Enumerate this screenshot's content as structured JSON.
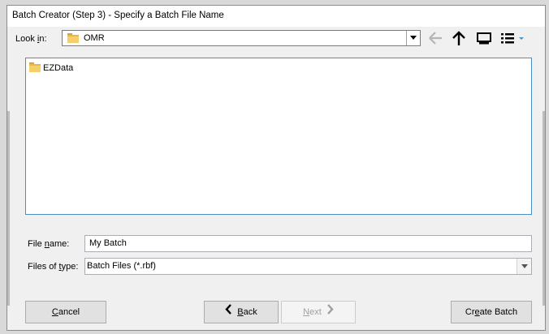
{
  "window": {
    "title": "Batch Creator (Step 3) - Specify a Batch File Name"
  },
  "lookin": {
    "label_pre": "Look ",
    "label_accel": "i",
    "label_post": "n:",
    "value": "OMR"
  },
  "toolbar": {
    "icons": [
      "back-arrow-icon",
      "up-folder-icon",
      "desktop-icon",
      "view-menu-icon"
    ]
  },
  "files": [
    {
      "name": "EZData",
      "icon": "folder-icon"
    }
  ],
  "filename": {
    "label_pre": "File ",
    "label_accel": "n",
    "label_post": "ame:",
    "value": "My Batch"
  },
  "filetype": {
    "label_pre": "Files of ",
    "label_accel": "t",
    "label_post": "ype:",
    "value": "Batch Files (*.rbf)"
  },
  "buttons": {
    "cancel_accel": "C",
    "cancel_rest": "ancel",
    "back_accel": "B",
    "back_rest": "ack",
    "next_accel": "N",
    "next_rest": "ext",
    "create_pre": "Cr",
    "create_accel": "e",
    "create_rest": "ate Batch"
  },
  "colors": {
    "accent_border": "#4a90c2",
    "folder": "#e8b84a",
    "disabled_text": "#a0a0a0"
  }
}
